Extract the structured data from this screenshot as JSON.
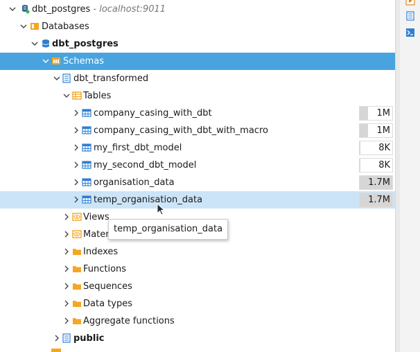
{
  "tree": {
    "connection": {
      "name": "dbt_postgres",
      "host": " - localhost:9011"
    },
    "databases_label": "Databases",
    "database": "dbt_postgres",
    "schemas_label": "Schemas",
    "schema": "dbt_transformed",
    "tables_label": "Tables",
    "tables": [
      {
        "name": "company_casing_with_dbt",
        "size": "1M",
        "fill": 0.25
      },
      {
        "name": "company_casing_with_dbt_with_macro",
        "size": "1M",
        "fill": 0.25
      },
      {
        "name": "my_first_dbt_model",
        "size": "8K",
        "fill": 0.02
      },
      {
        "name": "my_second_dbt_model",
        "size": "8K",
        "fill": 0.02
      },
      {
        "name": "organisation_data",
        "size": "1.7M",
        "fill": 1.0
      },
      {
        "name": "temp_organisation_data",
        "size": "1.7M",
        "fill": 1.0
      }
    ],
    "folders": [
      {
        "label": "Views"
      },
      {
        "label": "Mater"
      },
      {
        "label": "Indexes"
      },
      {
        "label": "Functions"
      },
      {
        "label": "Sequences"
      },
      {
        "label": "Data types"
      },
      {
        "label": "Aggregate functions"
      }
    ],
    "public_schema": "public"
  },
  "tooltip": "temp_organisation_data",
  "colors": {
    "selected": "#49a3de",
    "hover": "#cce4f7",
    "folder": "#f5a623",
    "table": "#2f7fd1"
  }
}
